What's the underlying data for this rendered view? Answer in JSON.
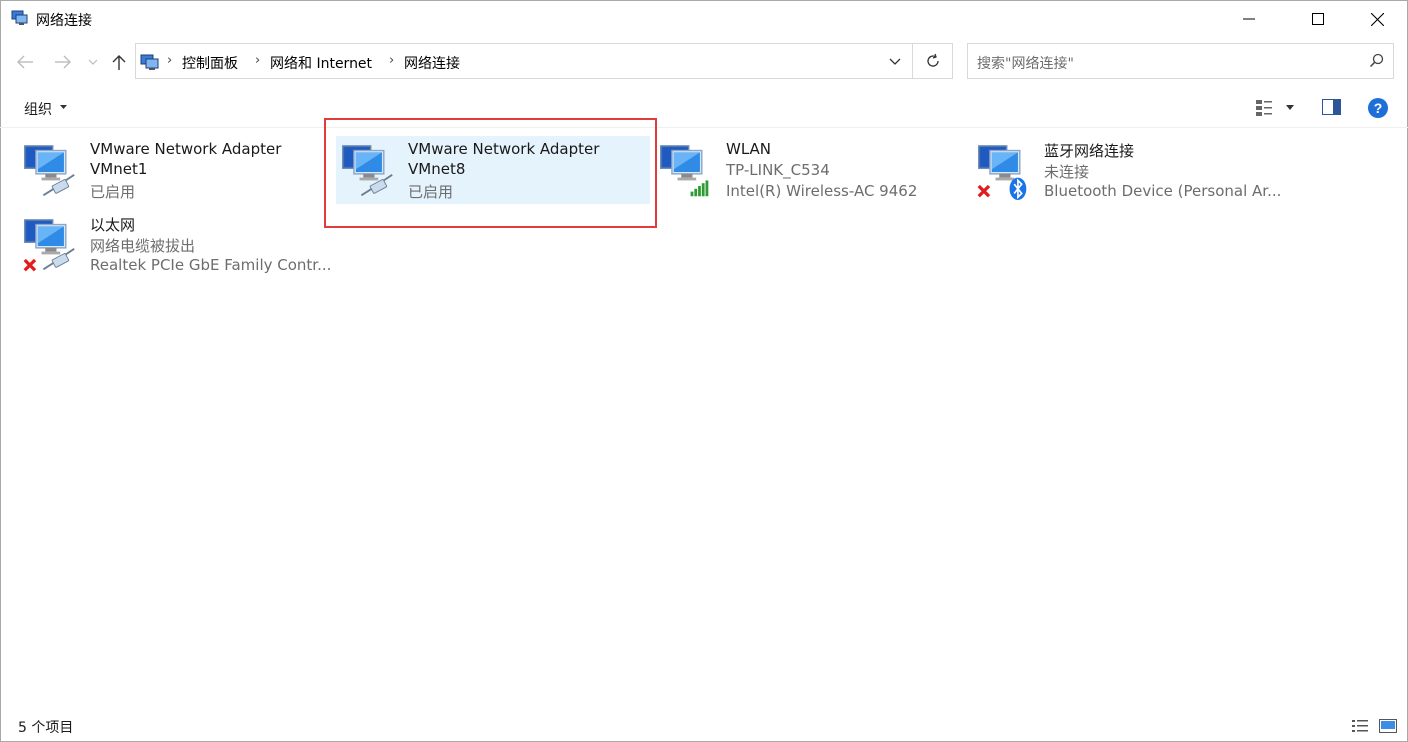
{
  "window": {
    "title": "网络连接"
  },
  "nav": {
    "breadcrumb": [
      "控制面板",
      "网络和 Internet",
      "网络连接"
    ],
    "search_placeholder": "搜索\"网络连接\""
  },
  "toolbar": {
    "organize_label": "组织"
  },
  "items": [
    {
      "name_line1": "VMware Network Adapter",
      "name_line2": "VMnet1",
      "status": "已启用",
      "selected": false,
      "badge": "cable"
    },
    {
      "name_line1": "VMware Network Adapter",
      "name_line2": "VMnet8",
      "status": "已启用",
      "selected": true,
      "badge": "cable"
    },
    {
      "name": "WLAN",
      "status": "TP-LINK_C534",
      "device": "Intel(R) Wireless-AC 9462",
      "badge": "signal"
    },
    {
      "name": "蓝牙网络连接",
      "status": "未连接",
      "device": "Bluetooth Device (Personal Ar...",
      "badge": "bluetooth-disconnected"
    },
    {
      "name": "以太网",
      "status": "网络电缆被拔出",
      "device": "Realtek PCIe GbE Family Contr...",
      "badge": "cable-disconnected"
    }
  ],
  "statusbar": {
    "count_text": "5 个项目"
  },
  "colors": {
    "selection": "#e5f3fd",
    "highlight_box": "#e03c3c",
    "help": "#1e6fd9"
  }
}
